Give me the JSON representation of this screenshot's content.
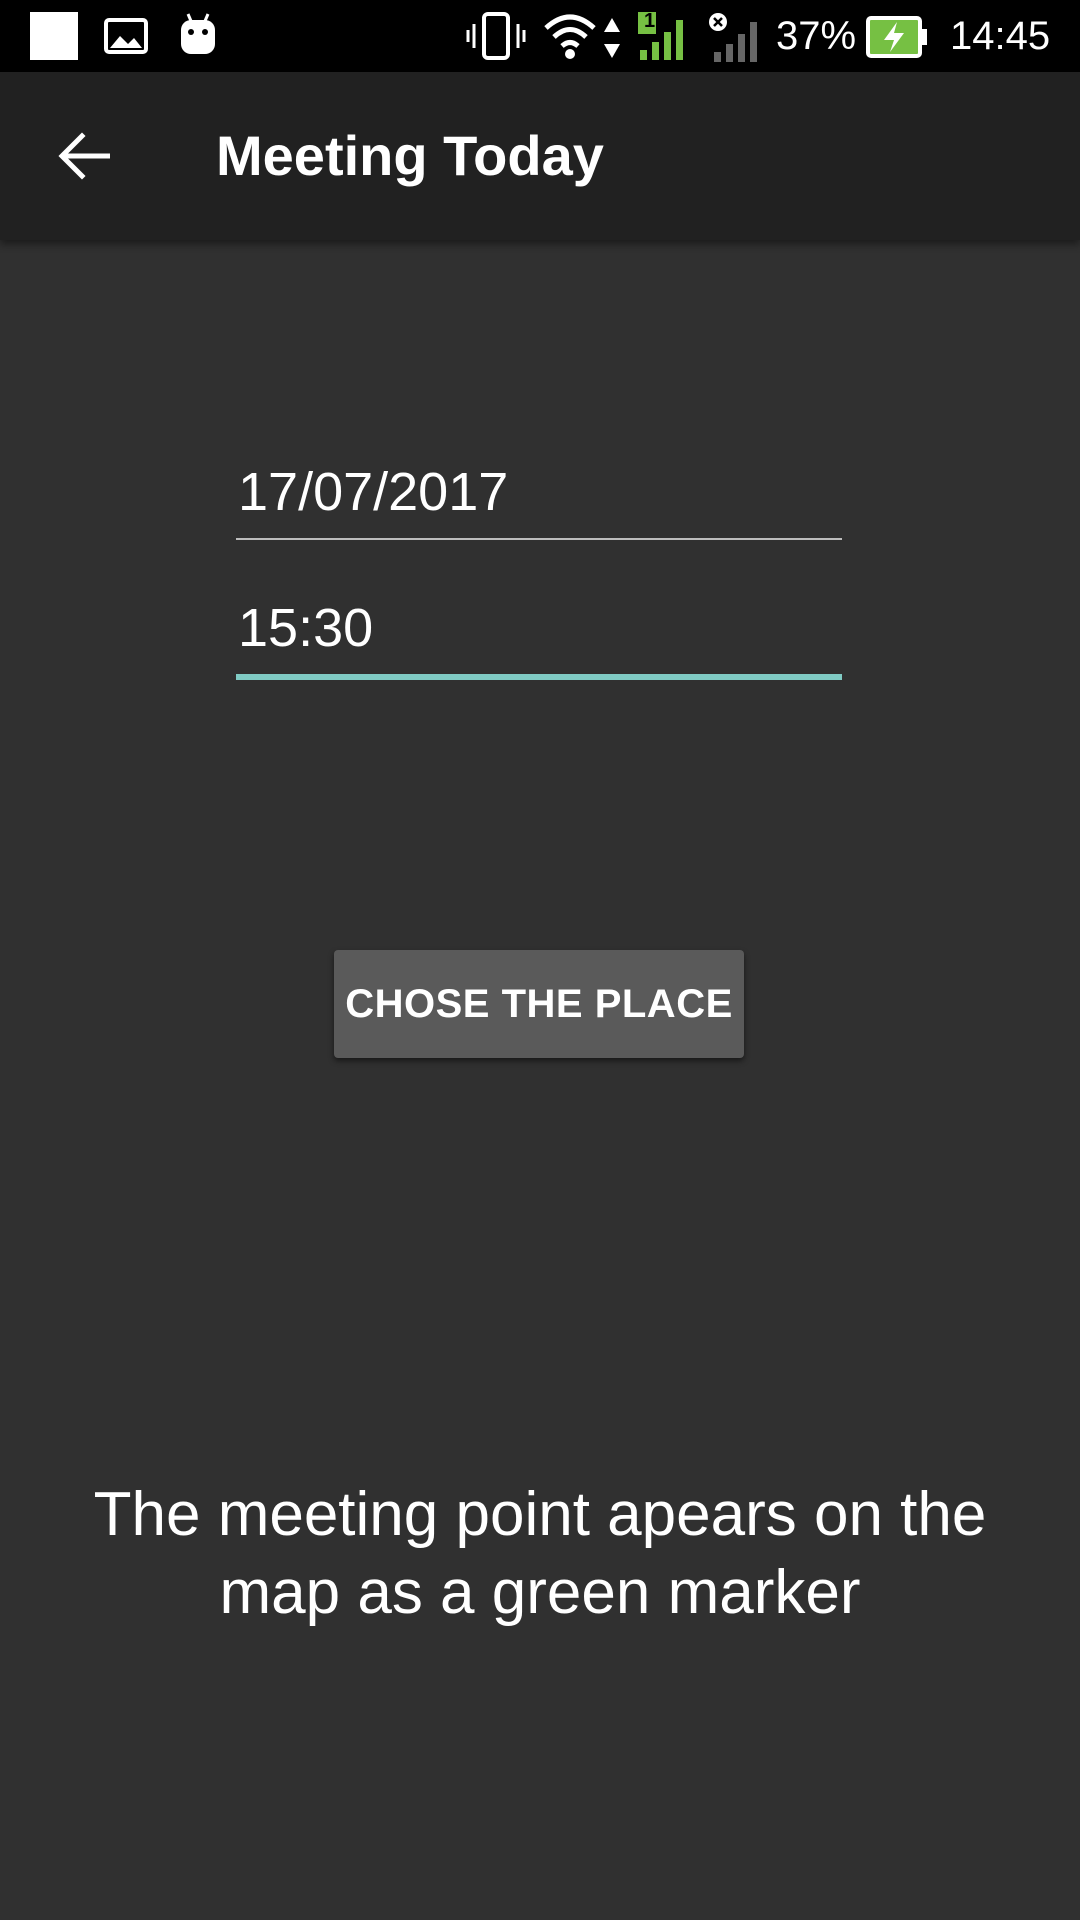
{
  "status_bar": {
    "battery_percent": "37%",
    "time": "14:45",
    "sim1_badge": "1",
    "icons": [
      "notification-square-icon",
      "gallery-icon",
      "android-icon",
      "vibrate-icon",
      "wifi-icon",
      "data-arrows-icon",
      "signal-sim1-icon",
      "signal-sim2-no-service-icon",
      "battery-charging-icon"
    ],
    "colors": {
      "signal_active": "#76c043",
      "signal_inactive": "#666666",
      "battery_fill": "#76c043"
    }
  },
  "app_bar": {
    "title": "Meeting Today",
    "back_icon": "arrow-back-icon"
  },
  "form": {
    "date_value": "17/07/2017",
    "time_value": "15:30",
    "focus_color": "#80cbc4"
  },
  "actions": {
    "chose_place_label": "CHOSE THE PLACE"
  },
  "info": {
    "message": "The meeting point apears on the map as a green marker"
  }
}
